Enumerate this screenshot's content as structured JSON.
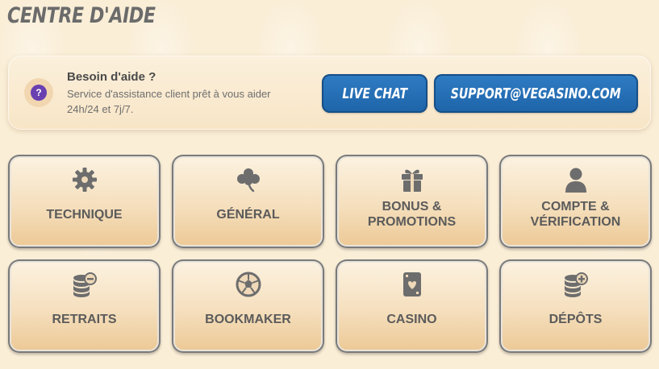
{
  "page": {
    "title": "CENTRE D'AIDE"
  },
  "help": {
    "title": "Besoin d'aide ?",
    "desc_line1": "Service d'assistance client prêt à vous aider",
    "desc_line2": "24h/24 et 7j/7.",
    "icon_glyph": "?",
    "live_chat_label": "LIVE CHAT",
    "email_label": "SUPPORT@VEGASINO.COM"
  },
  "categories": [
    {
      "icon": "gear-icon",
      "label1": "TECHNIQUE",
      "label2": ""
    },
    {
      "icon": "clover-icon",
      "label1": "GÉNÉRAL",
      "label2": ""
    },
    {
      "icon": "gift-icon",
      "label1": "BONUS &",
      "label2": "PROMOTIONS"
    },
    {
      "icon": "user-icon",
      "label1": "COMPTE &",
      "label2": "VÉRIFICATION"
    },
    {
      "icon": "coins-minus-icon",
      "label1": "RETRAITS",
      "label2": ""
    },
    {
      "icon": "soccer-ball-icon",
      "label1": "BOOKMAKER",
      "label2": ""
    },
    {
      "icon": "playing-card-icon",
      "label1": "CASINO",
      "label2": ""
    },
    {
      "icon": "coins-plus-icon",
      "label1": "DÉPÔTS",
      "label2": ""
    }
  ],
  "colors": {
    "background": "#faeed7",
    "accent_blue": "#1e64a8",
    "help_icon_purple": "#6a3fb0",
    "text_gray": "#5b5b5b"
  }
}
